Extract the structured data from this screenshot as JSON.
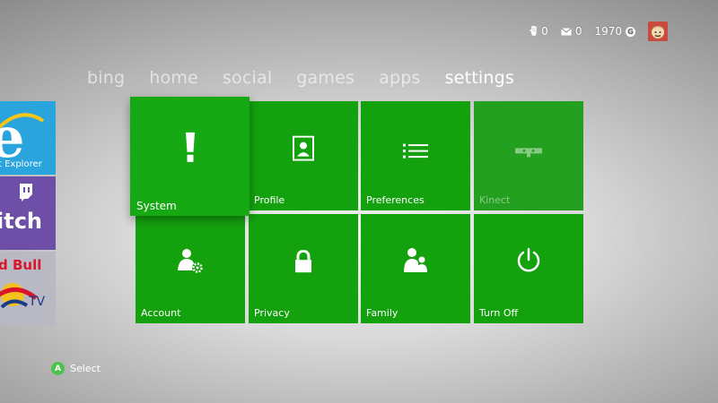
{
  "status": {
    "beacons": "0",
    "messages": "0",
    "gamerscore": "1970",
    "gamerscore_badge": "G"
  },
  "nav": {
    "items": [
      {
        "label": "bing",
        "active": false
      },
      {
        "label": "home",
        "active": false
      },
      {
        "label": "social",
        "active": false
      },
      {
        "label": "games",
        "active": false
      },
      {
        "label": "apps",
        "active": false
      },
      {
        "label": "settings",
        "active": true
      }
    ]
  },
  "peek_tiles": [
    {
      "label": "Internet Explorer",
      "visible_label": "t Explorer",
      "color": "#29a4dc"
    },
    {
      "label": "twitch",
      "visible_label": "itch",
      "color": "#6d4fa8"
    },
    {
      "label": "Red Bull TV",
      "visible_label": "d Bull",
      "color": "#b9b9c3"
    }
  ],
  "tiles": {
    "system": {
      "label": "System",
      "icon": "xbox-system-icon"
    },
    "profile": {
      "label": "Profile",
      "icon": "profile-icon"
    },
    "preferences": {
      "label": "Preferences",
      "icon": "list-icon"
    },
    "kinect": {
      "label": "Kinect",
      "icon": "kinect-icon",
      "disabled": true
    },
    "account": {
      "label": "Account",
      "icon": "account-gear-icon"
    },
    "privacy": {
      "label": "Privacy",
      "icon": "lock-icon"
    },
    "family": {
      "label": "Family",
      "icon": "family-icon"
    },
    "turnoff": {
      "label": "Turn Off",
      "icon": "power-icon"
    }
  },
  "colors": {
    "tile_green": "#13a10e",
    "focused_green": "#17a913",
    "a_button": "#4cc34c"
  },
  "footer": {
    "button_glyph": "A",
    "hint": "Select"
  }
}
